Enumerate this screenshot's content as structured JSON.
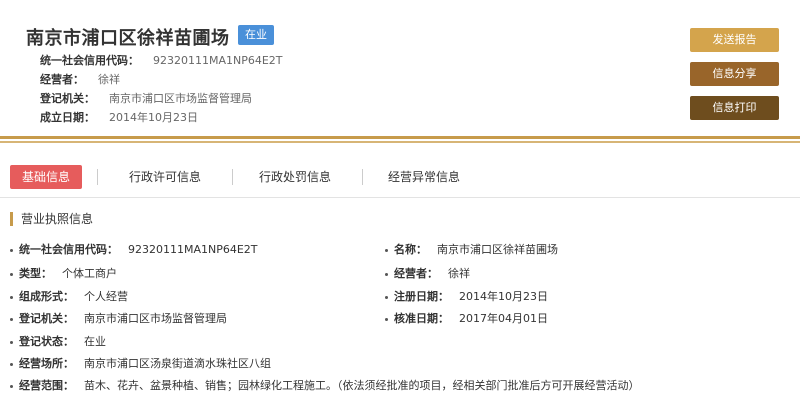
{
  "header": {
    "company_name": "南京市浦口区徐祥苗圃场",
    "status_badge": "在业",
    "rows": [
      {
        "label": "统一社会信用代码：",
        "value": "92320111MA1NP64E2T"
      },
      {
        "label": "经营者：",
        "value": "徐祥"
      },
      {
        "label": "登记机关：",
        "value": "南京市浦口区市场监督管理局"
      },
      {
        "label": "成立日期：",
        "value": "2014年10月23日"
      }
    ]
  },
  "actions": {
    "send_report": "发送报告",
    "share": "信息分享",
    "print": "信息打印"
  },
  "tabs": [
    {
      "label": "基础信息",
      "active": true
    },
    {
      "label": "行政许可信息",
      "active": false
    },
    {
      "label": "行政处罚信息",
      "active": false
    },
    {
      "label": "经营异常信息",
      "active": false
    }
  ],
  "section": {
    "title": "营业执照信息",
    "fields": {
      "credit_code": {
        "label": "统一社会信用代码：",
        "value": "92320111MA1NP64E2T"
      },
      "name": {
        "label": "名称：",
        "value": "南京市浦口区徐祥苗圃场"
      },
      "type": {
        "label": "类型：",
        "value": "个体工商户"
      },
      "operator": {
        "label": "经营者：",
        "value": "徐祥"
      },
      "form": {
        "label": "组成形式：",
        "value": "个人经营"
      },
      "reg_date": {
        "label": "注册日期：",
        "value": "2014年10月23日"
      },
      "authority": {
        "label": "登记机关：",
        "value": "南京市浦口区市场监督管理局"
      },
      "approval_date": {
        "label": "核准日期：",
        "value": "2017年04月01日"
      },
      "reg_status": {
        "label": "登记状态：",
        "value": "在业"
      },
      "location": {
        "label": "经营场所：",
        "value": "南京市浦口区汤泉街道滴水珠社区八组"
      },
      "scope": {
        "label": "经营范围：",
        "value": "苗木、花卉、盆景种植、销售；园林绿化工程施工。（依法须经批准的项目，经相关部门批准后方可开展经营活动）"
      }
    }
  },
  "colors": {
    "gold": "#c79b4b",
    "badge_blue": "#4a90d9",
    "active_tab": "#e65c5c",
    "btn_report": "#d4a44c",
    "btn_share": "#99652a",
    "btn_print": "#6e4d1e"
  }
}
